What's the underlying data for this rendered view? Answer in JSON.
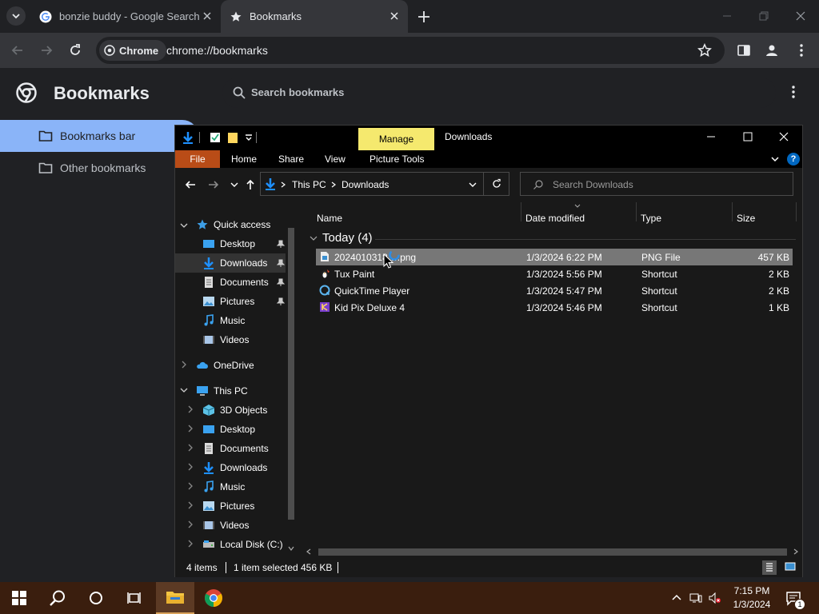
{
  "chrome": {
    "tabs": [
      {
        "title": "bonzie buddy - Google Search",
        "favicon": "google-g-icon"
      },
      {
        "title": "Bookmarks",
        "favicon": "star-icon"
      }
    ],
    "omnibox": {
      "chip_label": "Chrome",
      "url": "chrome://bookmarks"
    }
  },
  "bookmarks_page": {
    "title": "Bookmarks",
    "search_placeholder": "Search bookmarks",
    "sidebar": [
      {
        "label": "Bookmarks bar",
        "selected": true
      },
      {
        "label": "Other bookmarks",
        "selected": false
      }
    ]
  },
  "explorer": {
    "window_title": "Downloads",
    "manage_label": "Manage",
    "ribbon_tabs": [
      "File",
      "Home",
      "Share",
      "View",
      "Picture Tools"
    ],
    "breadcrumb": [
      "This PC",
      "Downloads"
    ],
    "search_placeholder": "Search Downloads",
    "nav": {
      "quick_access": "Quick access",
      "quick_items": [
        "Desktop",
        "Downloads",
        "Documents",
        "Pictures",
        "Music",
        "Videos"
      ],
      "onedrive": "OneDrive",
      "this_pc": "This PC",
      "pc_items": [
        "3D Objects",
        "Desktop",
        "Documents",
        "Downloads",
        "Music",
        "Pictures",
        "Videos",
        "Local Disk (C:)"
      ]
    },
    "columns": [
      "Name",
      "Date modified",
      "Type",
      "Size"
    ],
    "group_label": "Today (4)",
    "files": [
      {
        "name_prefix": "2024010318",
        "name_suffix": ".png",
        "date": "1/3/2024 6:22 PM",
        "type": "PNG File",
        "size": "457 KB",
        "selected": true,
        "icon": "png-file-icon"
      },
      {
        "name": "Tux Paint",
        "date": "1/3/2024 5:56 PM",
        "type": "Shortcut",
        "size": "2 KB",
        "selected": false,
        "icon": "tux-paint-icon"
      },
      {
        "name": "QuickTime Player",
        "date": "1/3/2024 5:47 PM",
        "type": "Shortcut",
        "size": "2 KB",
        "selected": false,
        "icon": "quicktime-icon"
      },
      {
        "name": "Kid Pix Deluxe 4",
        "date": "1/3/2024 5:46 PM",
        "type": "Shortcut",
        "size": "1 KB",
        "selected": false,
        "icon": "kidpix-icon"
      }
    ],
    "status": {
      "items": "4 items",
      "selected": "1 item selected",
      "size": "456 KB"
    }
  },
  "taskbar": {
    "time": "7:15 PM",
    "date": "1/3/2024",
    "notification_count": "1"
  }
}
